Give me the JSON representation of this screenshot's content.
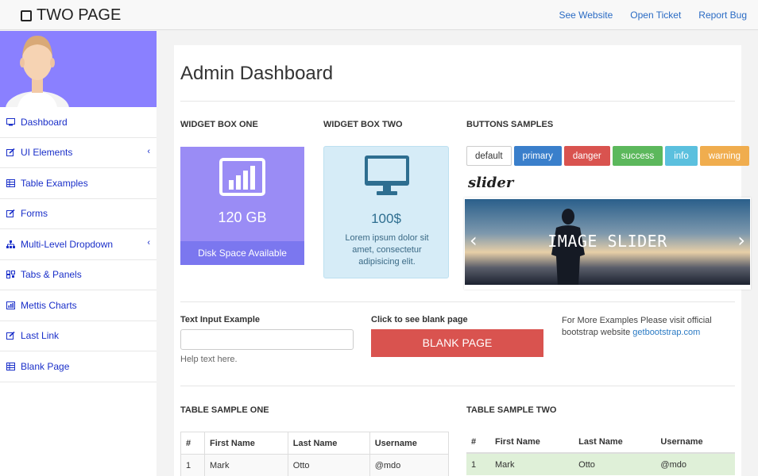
{
  "app": {
    "brand": "TWO PAGE"
  },
  "navbar": {
    "links": [
      "See Website",
      "Open Ticket",
      "Report Bug"
    ]
  },
  "sidebar": {
    "items": [
      {
        "label": "Dashboard",
        "icon": "monitor-icon",
        "has_submenu": false
      },
      {
        "label": "UI Elements",
        "icon": "edit-icon",
        "has_submenu": true
      },
      {
        "label": "Table Examples",
        "icon": "table-icon",
        "has_submenu": false
      },
      {
        "label": "Forms",
        "icon": "edit-icon",
        "has_submenu": false
      },
      {
        "label": "Multi-Level Dropdown",
        "icon": "sitemap-icon",
        "has_submenu": true
      },
      {
        "label": "Tabs & Panels",
        "icon": "qrcode-icon",
        "has_submenu": false
      },
      {
        "label": "Mettis Charts",
        "icon": "bar-chart-icon",
        "has_submenu": false
      },
      {
        "label": "Last Link",
        "icon": "edit-icon",
        "has_submenu": false
      },
      {
        "label": "Blank Page",
        "icon": "table-icon",
        "has_submenu": false
      }
    ],
    "avatar_bg": "#8a80ff"
  },
  "main": {
    "title": "Admin Dashboard",
    "widget_one": {
      "heading": "WIDGET BOX ONE",
      "value": "120 GB",
      "footer": "Disk Space Available",
      "icon": "bar-chart-icon"
    },
    "widget_two": {
      "heading": "WIDGET BOX TWO",
      "value": "100$",
      "description": "Lorem ipsum dolor sit amet, consectetur adipisicing elit.",
      "icon": "desktop-icon"
    },
    "buttons": {
      "heading": "BUTTONS SAMPLES",
      "items": [
        "default",
        "primary",
        "danger",
        "success",
        "info",
        "warning"
      ]
    },
    "slider": {
      "label": "slider",
      "caption": "IMAGE SLIDER"
    },
    "text_input": {
      "label": "Text Input Example",
      "value": "",
      "help": "Help text here."
    },
    "blank_page": {
      "label": "Click to see blank page",
      "button": "BLANK PAGE"
    },
    "more": {
      "text": "For More Examples Please visit official bootstrap website",
      "link": "getbootstrap.com"
    },
    "table_one": {
      "heading": "TABLE SAMPLE ONE",
      "columns": [
        "#",
        "First Name",
        "Last Name",
        "Username"
      ],
      "rows": [
        [
          "1",
          "Mark",
          "Otto",
          "@mdo"
        ]
      ]
    },
    "table_two": {
      "heading": "TABLE SAMPLE TWO",
      "columns": [
        "#",
        "First Name",
        "Last Name",
        "Username"
      ],
      "rows": [
        [
          "1",
          "Mark",
          "Otto",
          "@mdo"
        ]
      ]
    }
  }
}
